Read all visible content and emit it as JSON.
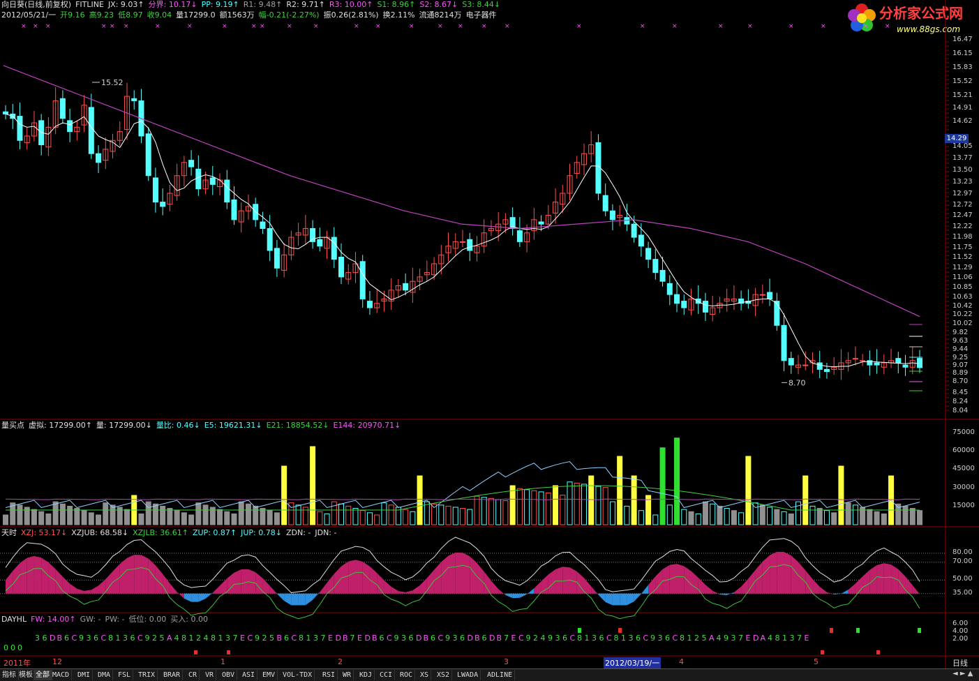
{
  "header": {
    "row1": [
      {
        "t": "向日葵(日线,前复权)",
        "c": "white"
      },
      {
        "t": "FITLINE",
        "c": "white"
      },
      {
        "t": "JX: 9.03↑",
        "c": "white"
      },
      {
        "t": "分界: 10.17↓",
        "c": "mag"
      },
      {
        "t": "PP: 9.19↑",
        "c": "cyan"
      },
      {
        "t": "R1: 9.48↑",
        "c": "gray"
      },
      {
        "t": "R2: 9.71↑",
        "c": "white"
      },
      {
        "t": "R3: 10.00↑",
        "c": "mag"
      },
      {
        "t": "S1: 8.96↑",
        "c": "green"
      },
      {
        "t": "S2: 8.67↓",
        "c": "mag"
      },
      {
        "t": "S3: 8.44↓",
        "c": "green"
      }
    ],
    "row2": [
      {
        "t": "2012/05/21/一",
        "c": "white"
      },
      {
        "t": "开9.16",
        "c": "green"
      },
      {
        "t": "高9.23",
        "c": "green"
      },
      {
        "t": "低8.97",
        "c": "green"
      },
      {
        "t": "收9.04",
        "c": "green"
      },
      {
        "t": "量17299.0",
        "c": "white"
      },
      {
        "t": "额1563万",
        "c": "white"
      },
      {
        "t": "幅-0.21(-2.27%)",
        "c": "green"
      },
      {
        "t": "振0.26(2.81%)",
        "c": "white"
      },
      {
        "t": "换2.11%",
        "c": "white"
      },
      {
        "t": "流通8214万",
        "c": "white"
      },
      {
        "t": "电子器件",
        "c": "white"
      }
    ]
  },
  "logo": {
    "brand": "分析家公式网",
    "url": "www.88gs.com"
  },
  "volume_header": [
    {
      "t": "量买点",
      "c": "white"
    },
    {
      "t": "虚拟: 17299.00↑",
      "c": "white"
    },
    {
      "t": "量: 17299.00↓",
      "c": "white"
    },
    {
      "t": "量比: 0.46↓",
      "c": "cyan"
    },
    {
      "t": "E5: 19621.31↓",
      "c": "cyan"
    },
    {
      "t": "E21: 18854.52↓",
      "c": "green"
    },
    {
      "t": "E144: 20970.71↓",
      "c": "mag"
    }
  ],
  "osc_header": [
    {
      "t": "天时",
      "c": "white"
    },
    {
      "t": "XZJ: 53.17↓",
      "c": "red"
    },
    {
      "t": "XZJUB: 68.58↓",
      "c": "white"
    },
    {
      "t": "XZJLB: 36.61↑",
      "c": "green"
    },
    {
      "t": "ZUP: 0.87↑",
      "c": "cyan"
    },
    {
      "t": "JUP: 0.78↓",
      "c": "cyan"
    },
    {
      "t": "ZDN: -",
      "c": "white"
    },
    {
      "t": "JDN: -",
      "c": "white"
    }
  ],
  "dayhl_header": [
    {
      "t": "DAYHL",
      "c": "white"
    },
    {
      "t": "FW: 14.00↑",
      "c": "mag"
    },
    {
      "t": "GW: -",
      "c": "gray"
    },
    {
      "t": "PW: -",
      "c": "gray"
    },
    {
      "t": "低位: 0.00",
      "c": "gray"
    },
    {
      "t": "买入: 0.00",
      "c": "gray"
    }
  ],
  "price_axis": [
    "16.47",
    "16.15",
    "15.83",
    "15.52",
    "15.21",
    "14.91",
    "14.62",
    "14.05",
    "13.77",
    "13.50",
    "13.23",
    "12.97",
    "12.72",
    "12.47",
    "12.22",
    "11.98",
    "11.75",
    "11.52",
    "11.29",
    "11.06",
    "10.85",
    "10.63",
    "10.42",
    "10.22",
    "10.02",
    "9.82",
    "9.63",
    "9.44",
    "9.25",
    "9.07",
    "8.89",
    "8.70",
    "8.45",
    "8.24",
    "8.04"
  ],
  "current_price_tag": "14.29",
  "volume_axis": [
    "75000",
    "60000",
    "45000",
    "30000",
    "15000"
  ],
  "osc_axis": [
    "80.00",
    "70.00",
    "50.00",
    "35.00"
  ],
  "dayhl_axis": [
    "6.00",
    "4.00",
    "2.00"
  ],
  "annotations": {
    "high": "15.52",
    "low": "8.70"
  },
  "date_axis": {
    "labels": [
      {
        "t": "2011年",
        "x": 5
      },
      {
        "t": "12",
        "x": 75
      },
      {
        "t": "1",
        "x": 316
      },
      {
        "t": "2",
        "x": 484
      },
      {
        "t": "3",
        "x": 722
      },
      {
        "t": "2012/03/19/一",
        "x": 865
      },
      {
        "t": "4",
        "x": 973
      },
      {
        "t": "5",
        "x": 1166
      }
    ],
    "right_label": "日线"
  },
  "tabs": [
    "指标",
    "模板",
    "全部",
    "MACD",
    "DMI",
    "DMA",
    "FSL",
    "TRIX",
    "BRAR",
    "CR",
    "VR",
    "OBV",
    "ASI",
    "EMV",
    "VOL-TDX",
    "RSI",
    "WR",
    "KDJ",
    "CCI",
    "ROC",
    "XS",
    "XS2",
    "LWADA",
    "ADLINE"
  ],
  "active_tab": "全部",
  "dayhl_text_row1": "3 6 D B 6 C 9 3 6 C 8 1 3 6 C 9 2 5 A 4 8 1 2 4 8 1 3 7 E C 9 2 5 B 6 C 8 1 3 7 E D B 7 E D B 6 C 9 3 6 D B 6 C 9 3 6 D B 6 D B 7 E C 9 2 4 9 3 6 C 8 1 3 6 C 8 1 3 6 C 9 3 6 C 8 1 2 5 A 4 9 3 7 E D A 4 8 1 3 7 E",
  "chart_data": {
    "type": "candlestick",
    "title": "向日葵(日线,前复权)",
    "x_range": [
      "2011-11",
      "2012-05-21"
    ],
    "ylim": [
      8.04,
      16.47
    ],
    "last_bar": {
      "date": "2012/05/21",
      "open": 9.16,
      "high": 9.23,
      "low": 8.97,
      "close": 9.04,
      "volume": 17299.0
    },
    "closes": [
      14.8,
      14.7,
      14.2,
      14.3,
      14.6,
      14.1,
      14.5,
      15.1,
      14.7,
      14.4,
      14.5,
      15.0,
      13.9,
      13.7,
      14.0,
      14.2,
      14.4,
      15.2,
      15.1,
      14.3,
      13.4,
      12.8,
      12.7,
      13.0,
      13.4,
      13.7,
      13.6,
      13.1,
      13.3,
      13.2,
      13.3,
      12.8,
      12.4,
      12.6,
      12.7,
      12.4,
      12.2,
      11.7,
      11.3,
      11.6,
      12.0,
      12.1,
      12.2,
      11.9,
      11.8,
      12.0,
      11.5,
      11.1,
      11.2,
      11.4,
      10.6,
      10.4,
      10.5,
      10.6,
      10.8,
      10.9,
      10.8,
      11.0,
      11.1,
      11.2,
      11.4,
      11.6,
      11.8,
      11.9,
      11.9,
      11.7,
      11.8,
      12.1,
      12.2,
      12.3,
      12.4,
      12.2,
      11.9,
      12.1,
      12.4,
      12.3,
      12.5,
      12.8,
      13.0,
      13.4,
      13.7,
      13.9,
      14.1,
      13.0,
      12.6,
      12.4,
      12.5,
      12.3,
      12.0,
      11.8,
      11.5,
      11.2,
      11.0,
      10.7,
      10.5,
      10.4,
      10.6,
      10.5,
      10.3,
      10.4,
      10.5,
      10.6,
      10.6,
      10.5,
      10.5,
      10.7,
      10.7,
      10.6,
      10.0,
      9.2,
      9.1,
      9.1,
      9.1,
      9.2,
      9.0,
      8.95,
      9.05,
      9.15,
      9.2,
      9.25,
      9.2,
      9.1,
      9.1,
      9.15,
      9.2,
      9.15,
      9.05,
      9.2,
      9.04
    ],
    "series": [
      {
        "name": "JX",
        "values_ref": "closes"
      },
      {
        "name": "分界",
        "values": [
          15.9,
          15.4,
          14.9,
          14.4,
          13.9,
          13.4,
          13.0,
          12.6,
          12.3,
          12.2,
          12.3,
          12.4,
          12.2,
          11.9,
          11.4,
          10.8,
          10.2
        ]
      }
    ],
    "volume": {
      "series": [
        "E5",
        "E21",
        "E144"
      ],
      "last": {
        "虚拟": 17299.0,
        "量": 17299.0,
        "量比": 0.46,
        "E5": 19621.31,
        "E21": 18854.52,
        "E144": 20970.71
      }
    },
    "oscillator": {
      "name": "天时",
      "XZJ": 53.17,
      "XZJUB": 68.58,
      "XZJLB": 36.61,
      "ZUP": 0.87,
      "JUP": 0.78,
      "levels": [
        80,
        70,
        50,
        35
      ]
    }
  }
}
